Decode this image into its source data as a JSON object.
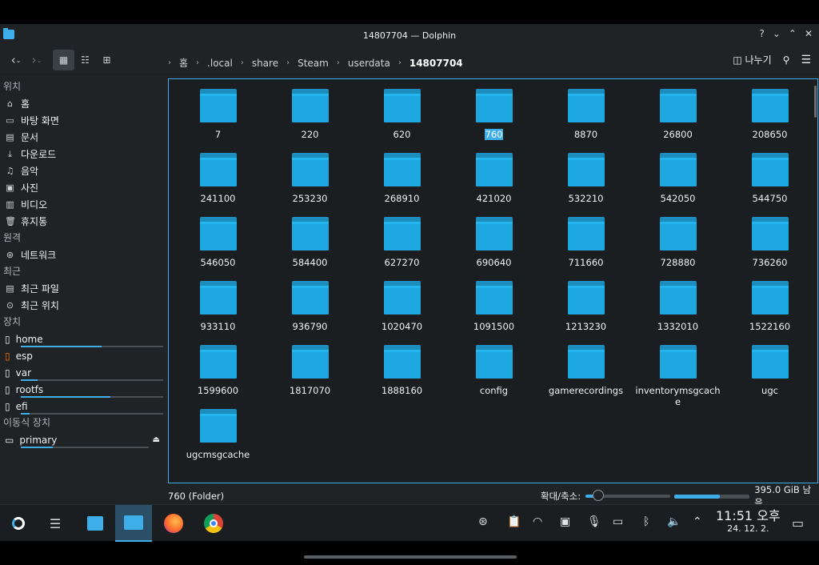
{
  "window": {
    "title": "14807704 — Dolphin",
    "buttons": [
      "?",
      "⌄",
      "⌃",
      "✕"
    ]
  },
  "toolbar": {
    "back": "‹",
    "forward": "›",
    "breadcrumb": [
      "홈",
      ".local",
      "share",
      "Steam",
      "userdata",
      "14807704"
    ],
    "split_label": "나누기"
  },
  "sidebar": {
    "places_title": "위치",
    "places": [
      {
        "label": "홈",
        "icon": "home-icon"
      },
      {
        "label": "바탕 화면",
        "icon": "desktop-icon"
      },
      {
        "label": "문서",
        "icon": "document-icon"
      },
      {
        "label": "다운로드",
        "icon": "download-icon"
      },
      {
        "label": "음악",
        "icon": "music-icon"
      },
      {
        "label": "사진",
        "icon": "picture-icon"
      },
      {
        "label": "비디오",
        "icon": "video-icon"
      },
      {
        "label": "휴지통",
        "icon": "trash-icon"
      }
    ],
    "remote_title": "원격",
    "remote": [
      {
        "label": "네트워크"
      }
    ],
    "recent_title": "최근",
    "recent": [
      {
        "label": "최근 파일"
      },
      {
        "label": "최근 위치"
      }
    ],
    "devices_title": "장치",
    "devices": [
      {
        "label": "home",
        "usage": 0.57
      },
      {
        "label": "esp",
        "usage": null
      },
      {
        "label": "var",
        "usage": 0.12
      },
      {
        "label": "rootfs",
        "usage": 0.63
      },
      {
        "label": "efi",
        "usage": 0.06
      }
    ],
    "removable_title": "이동식 장치",
    "removable": [
      {
        "label": "primary",
        "usage": 0.25
      }
    ]
  },
  "folders": [
    "7",
    "220",
    "620",
    "760",
    "8870",
    "26800",
    "208650",
    "241100",
    "253230",
    "268910",
    "421020",
    "532210",
    "542050",
    "544750",
    "546050",
    "584400",
    "627270",
    "690640",
    "711660",
    "728880",
    "736260",
    "933110",
    "936790",
    "1020470",
    "1091500",
    "1213230",
    "1332010",
    "1522160",
    "1599600",
    "1817070",
    "1888160",
    "config",
    "gamerecordings",
    "inventorymsgcache",
    "ugc",
    "ugcmsgcache"
  ],
  "selected_folder": "760",
  "status": {
    "selection": "760 (Folder)",
    "zoom_label": "확대/축소:",
    "zoom_level": 0.15,
    "free_space": "395.0 GiB 남음",
    "used_fraction": 0.6
  },
  "taskbar": {
    "time": "11:51 오후",
    "date": "24. 12. 2."
  },
  "colors": {
    "accent": "#3daee9",
    "folder": "#1ea8e2",
    "background": "#202326"
  }
}
